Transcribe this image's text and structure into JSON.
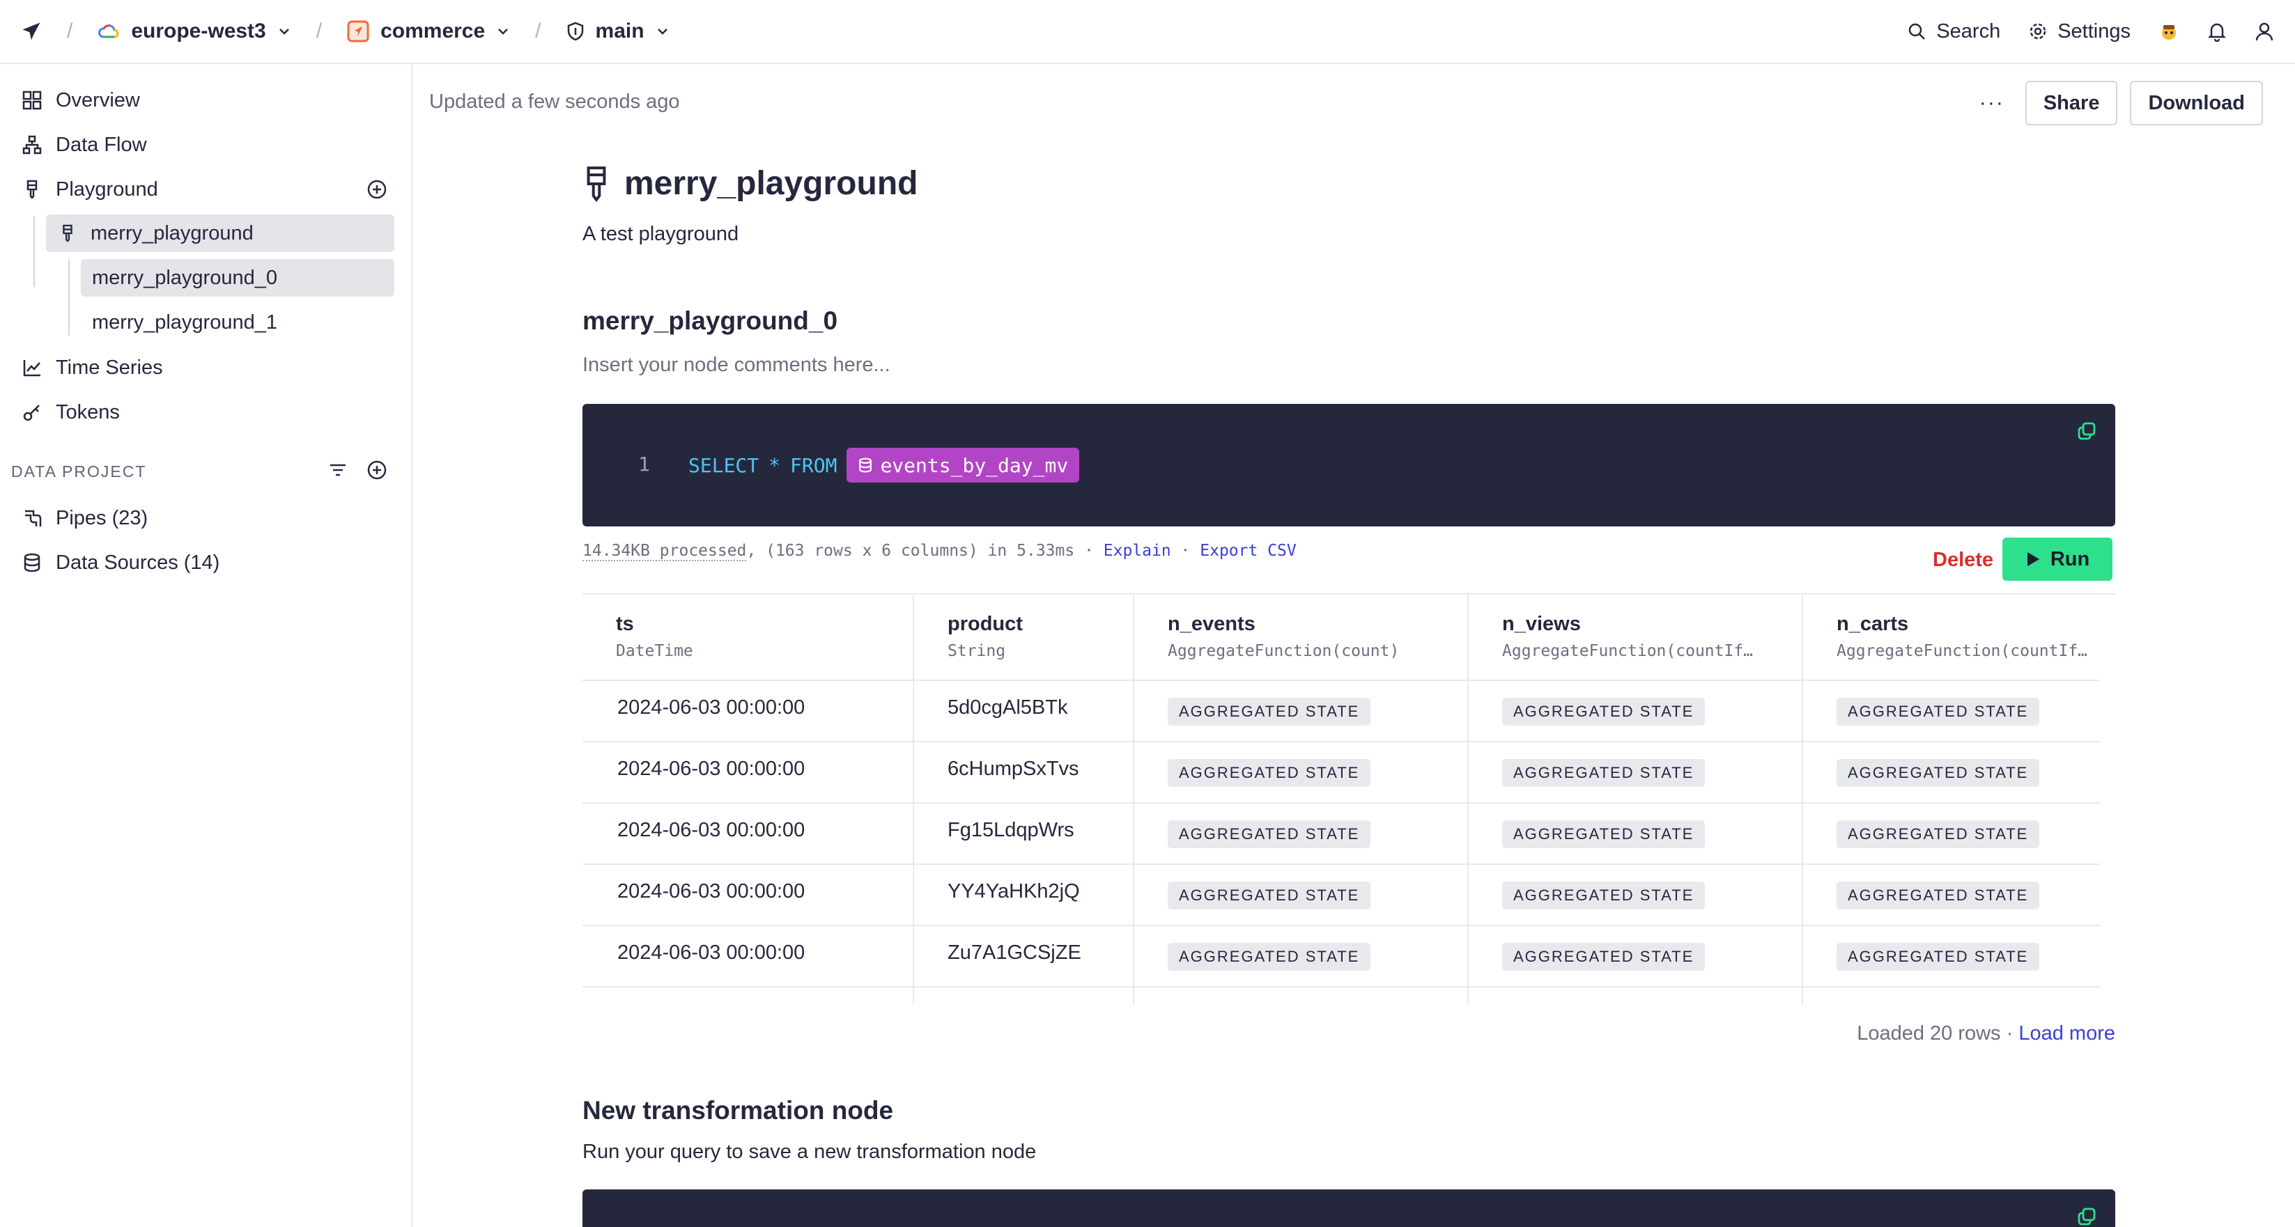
{
  "topbar": {
    "region": "europe-west3",
    "workspace": "commerce",
    "branch": "main",
    "search_label": "Search",
    "settings_label": "Settings",
    "separator": "/"
  },
  "sidebar": {
    "items": [
      {
        "label": "Overview",
        "icon": "grid-icon"
      },
      {
        "label": "Data Flow",
        "icon": "flow-icon"
      },
      {
        "label": "Playground",
        "icon": "playground-icon"
      },
      {
        "label": "Time Series",
        "icon": "chart-line-icon"
      },
      {
        "label": "Tokens",
        "icon": "key-icon"
      }
    ],
    "playground_children": {
      "parent": "merry_playground",
      "nodes": [
        "merry_playground_0",
        "merry_playground_1"
      ]
    },
    "section_label": "DATA PROJECT",
    "project_items": [
      {
        "label": "Pipes (23)",
        "icon": "pipe-icon"
      },
      {
        "label": "Data Sources (14)",
        "icon": "database-icon"
      }
    ]
  },
  "header": {
    "updated": "Updated a few seconds ago",
    "more_label": "···",
    "share_label": "Share",
    "download_label": "Download"
  },
  "playground": {
    "title": "merry_playground",
    "description": "A test playground"
  },
  "node0": {
    "title": "merry_playground_0",
    "comment_placeholder": "Insert your node comments here...",
    "sql": {
      "line_number": "1",
      "select": "SELECT",
      "star": "*",
      "from": "FROM",
      "datasource": "events_by_day_mv"
    },
    "stats": {
      "processed": "14.34KB processed",
      "detail": ", (163 rows x 6 columns) in 5.33ms",
      "sep": " · ",
      "explain": "Explain",
      "export": "Export CSV"
    },
    "delete_label": "Delete",
    "run_label": "Run",
    "columns": [
      {
        "name": "ts",
        "type": "DateTime"
      },
      {
        "name": "product",
        "type": "String"
      },
      {
        "name": "n_events",
        "type": "AggregateFunction(count)"
      },
      {
        "name": "n_views",
        "type": "AggregateFunction(countIf…"
      },
      {
        "name": "n_carts",
        "type": "AggregateFunction(countIf…"
      }
    ],
    "badge_text": "AGGREGATED STATE",
    "rows": [
      {
        "ts": "2024-06-03 00:00:00",
        "product": "5d0cgAl5BTk"
      },
      {
        "ts": "2024-06-03 00:00:00",
        "product": "6cHumpSxTvs"
      },
      {
        "ts": "2024-06-03 00:00:00",
        "product": "Fg15LdqpWrs"
      },
      {
        "ts": "2024-06-03 00:00:00",
        "product": "YY4YaHKh2jQ"
      },
      {
        "ts": "2024-06-03 00:00:00",
        "product": "Zu7A1GCSjZE"
      }
    ],
    "loaded_text": "Loaded 20 rows · ",
    "load_more": "Load more"
  },
  "new_node": {
    "title": "New transformation node",
    "hint": "Run your query to save a new transformation node"
  },
  "colors": {
    "accent_run": "#2ee08b",
    "datasource_chip": "#b245c5",
    "editor_bg": "#25283d",
    "link": "#3a3fd8",
    "danger": "#d92d2d"
  }
}
